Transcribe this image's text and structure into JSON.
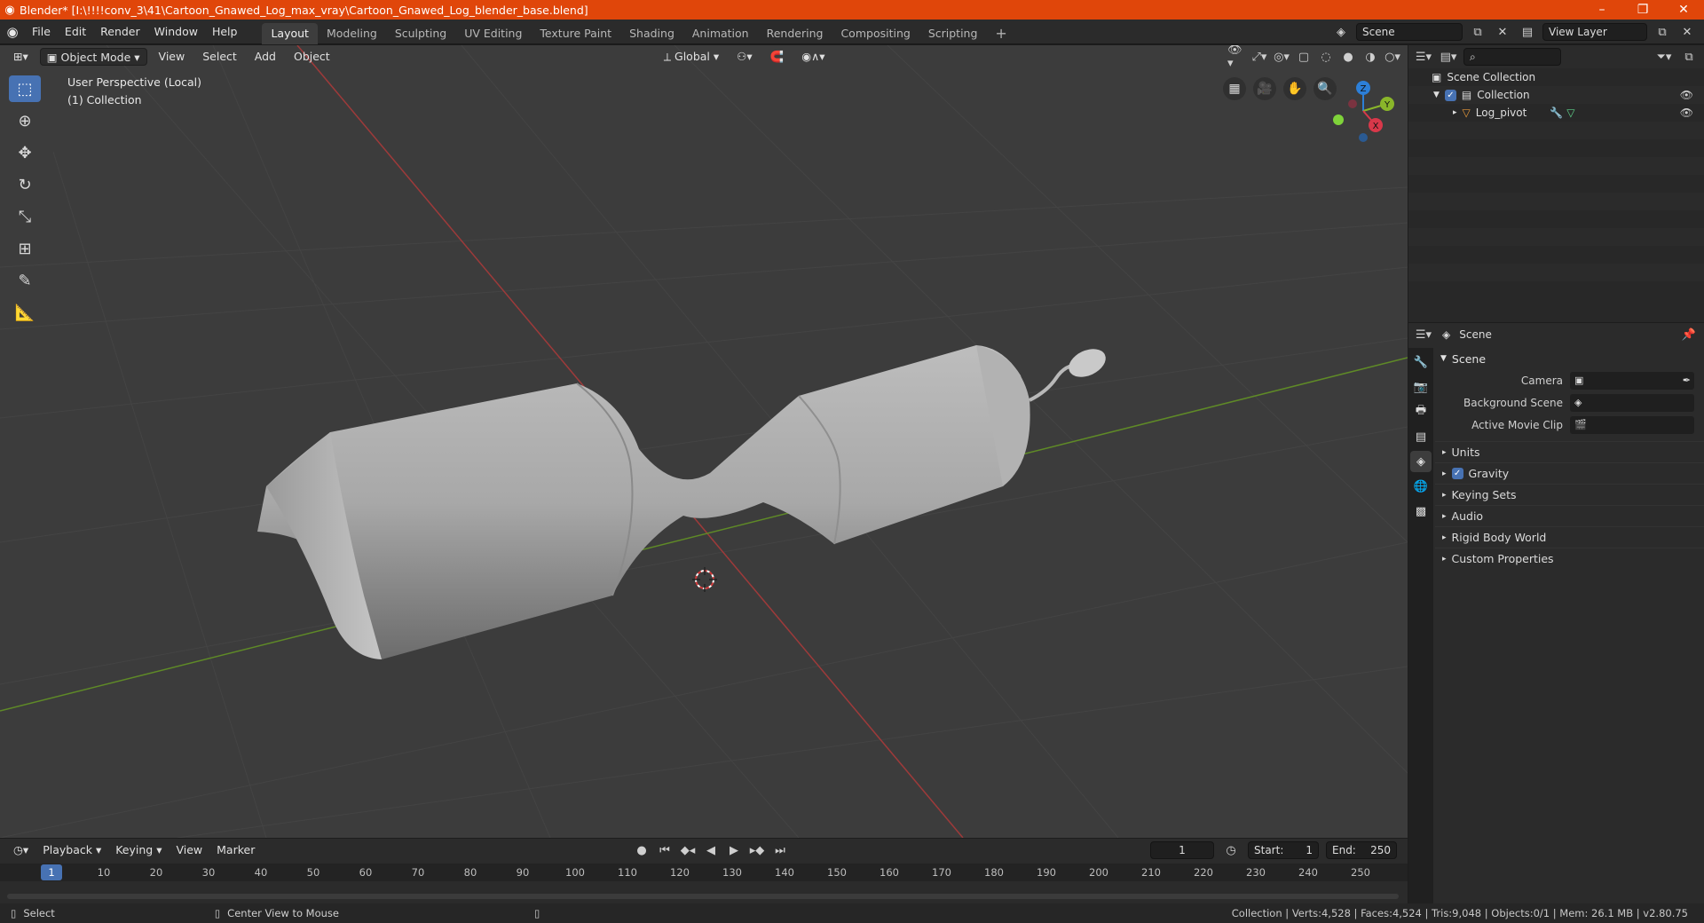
{
  "window": {
    "title": "Blender* [I:\\!!!!conv_3\\41\\Cartoon_Gnawed_Log_max_vray\\Cartoon_Gnawed_Log_blender_base.blend]"
  },
  "menus": [
    "File",
    "Edit",
    "Render",
    "Window",
    "Help"
  ],
  "workspaces": [
    "Layout",
    "Modeling",
    "Sculpting",
    "UV Editing",
    "Texture Paint",
    "Shading",
    "Animation",
    "Rendering",
    "Compositing",
    "Scripting"
  ],
  "active_workspace": "Layout",
  "topright": {
    "scene": "Scene",
    "view_layer": "View Layer"
  },
  "viewport": {
    "mode": "Object Mode",
    "menus": [
      "View",
      "Select",
      "Add",
      "Object"
    ],
    "transform_orientation": "Global",
    "perspective_label": "User Perspective (Local)",
    "collection_label": "(1) Collection",
    "gizmo": {
      "z": "Z",
      "y": "Y",
      "x": "X"
    }
  },
  "outliner": {
    "root": "Scene Collection",
    "collection": "Collection",
    "object": "Log_pivot"
  },
  "properties": {
    "context": "Scene",
    "panel": "Scene",
    "fields": {
      "camera": "Camera",
      "background_scene": "Background Scene",
      "active_movie_clip": "Active Movie Clip"
    },
    "subpanels": [
      "Units",
      "Gravity",
      "Keying Sets",
      "Audio",
      "Rigid Body World",
      "Custom Properties"
    ]
  },
  "timeline": {
    "menus": [
      "Playback",
      "Keying",
      "View",
      "Marker"
    ],
    "current_frame": "1",
    "start_label": "Start:",
    "start": "1",
    "end_label": "End:",
    "end": "250",
    "ticks": [
      "10",
      "20",
      "30",
      "40",
      "50",
      "60",
      "70",
      "80",
      "90",
      "100",
      "110",
      "120",
      "130",
      "140",
      "150",
      "160",
      "170",
      "180",
      "190",
      "200",
      "210",
      "220",
      "230",
      "240",
      "250"
    ],
    "cursor_label": "1"
  },
  "statusbar": {
    "select": "Select",
    "center_view": "Center View to Mouse",
    "stats": "Collection | Verts:4,528 | Faces:4,524 | Tris:9,048 | Objects:0/1 | Mem: 26.1 MB | v2.80.75"
  },
  "colors": {
    "accent": "#4772b3",
    "titlebar": "#e0460a",
    "viewport_bg": "#3c3c3c",
    "x_axis": "#b23a3a",
    "y_axis": "#6f9b2c"
  }
}
